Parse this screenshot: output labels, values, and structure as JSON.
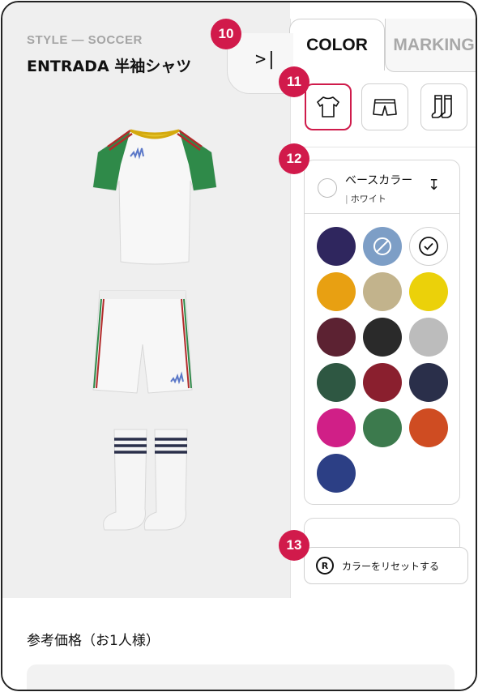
{
  "product": {
    "style_label": "STYLE — SOCCER",
    "title": "ENTRADA 半袖シャツ"
  },
  "collapse": {
    "glyph": ">|"
  },
  "tabs": [
    {
      "label": "COLOR",
      "active": true
    },
    {
      "label": "MARKING",
      "active": false
    }
  ],
  "garment_buttons": [
    {
      "name": "shirt-icon",
      "active": true
    },
    {
      "name": "shorts-icon",
      "active": false
    },
    {
      "name": "socks-icon",
      "active": false
    }
  ],
  "color_section": {
    "label": "ベースカラー",
    "value": "ホワイト",
    "swatches": [
      {
        "color": "#2f265e"
      },
      {
        "color": "#7d9ec6",
        "state": "unavailable"
      },
      {
        "color": "#ffffff",
        "state": "selected"
      },
      {
        "color": "#e8a012"
      },
      {
        "color": "#c2b38c"
      },
      {
        "color": "#ebd10a"
      },
      {
        "color": "#5c2232"
      },
      {
        "color": "#2a2a2a"
      },
      {
        "color": "#bcbcbc"
      },
      {
        "color": "#2e5742"
      },
      {
        "color": "#8a1f2e"
      },
      {
        "color": "#2a2f4a"
      },
      {
        "color": "#d01f87"
      },
      {
        "color": "#3c7a4d"
      },
      {
        "color": "#cf4c22"
      },
      {
        "color": "#2c3f85"
      }
    ]
  },
  "reset": {
    "icon_text": "R",
    "label": "カラーをリセットする"
  },
  "price": {
    "label": "参考価格（お1人様）"
  },
  "badges": [
    "10",
    "11",
    "12",
    "13"
  ],
  "colors": {
    "accent": "#d11a4b",
    "selected_border": "#cf1b4b"
  }
}
